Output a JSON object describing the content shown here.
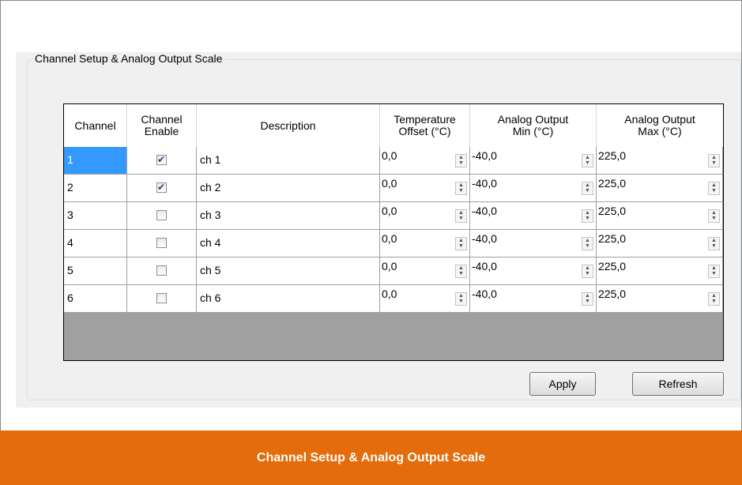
{
  "group": {
    "title": "Channel Setup & Analog Output Scale"
  },
  "columns": [
    "Channel",
    "Channel\nEnable",
    "Description",
    "Temperature\nOffset (°C)",
    "Analog Output\nMin (°C)",
    "Analog Output\nMax (°C)"
  ],
  "rows": [
    {
      "channel": "1",
      "enabled": true,
      "description": "ch 1",
      "offset": "0,0",
      "min": "-40,0",
      "max": "225,0",
      "selected": true
    },
    {
      "channel": "2",
      "enabled": true,
      "description": "ch 2",
      "offset": "0,0",
      "min": "-40,0",
      "max": "225,0"
    },
    {
      "channel": "3",
      "enabled": false,
      "description": "ch 3",
      "offset": "0,0",
      "min": "-40,0",
      "max": "225,0"
    },
    {
      "channel": "4",
      "enabled": false,
      "description": "ch 4",
      "offset": "0,0",
      "min": "-40,0",
      "max": "225,0"
    },
    {
      "channel": "5",
      "enabled": false,
      "description": "ch 5",
      "offset": "0,0",
      "min": "-40,0",
      "max": "225,0"
    },
    {
      "channel": "6",
      "enabled": false,
      "description": "ch 6",
      "offset": "0,0",
      "min": "-40,0",
      "max": "225,0"
    }
  ],
  "buttons": {
    "apply": "Apply",
    "refresh": "Refresh"
  },
  "caption": "Channel Setup & Analog Output Scale",
  "colors": {
    "caption_bg": "#e46c0a",
    "selection": "#3399ff",
    "grid_empty": "#a0a0a0"
  }
}
